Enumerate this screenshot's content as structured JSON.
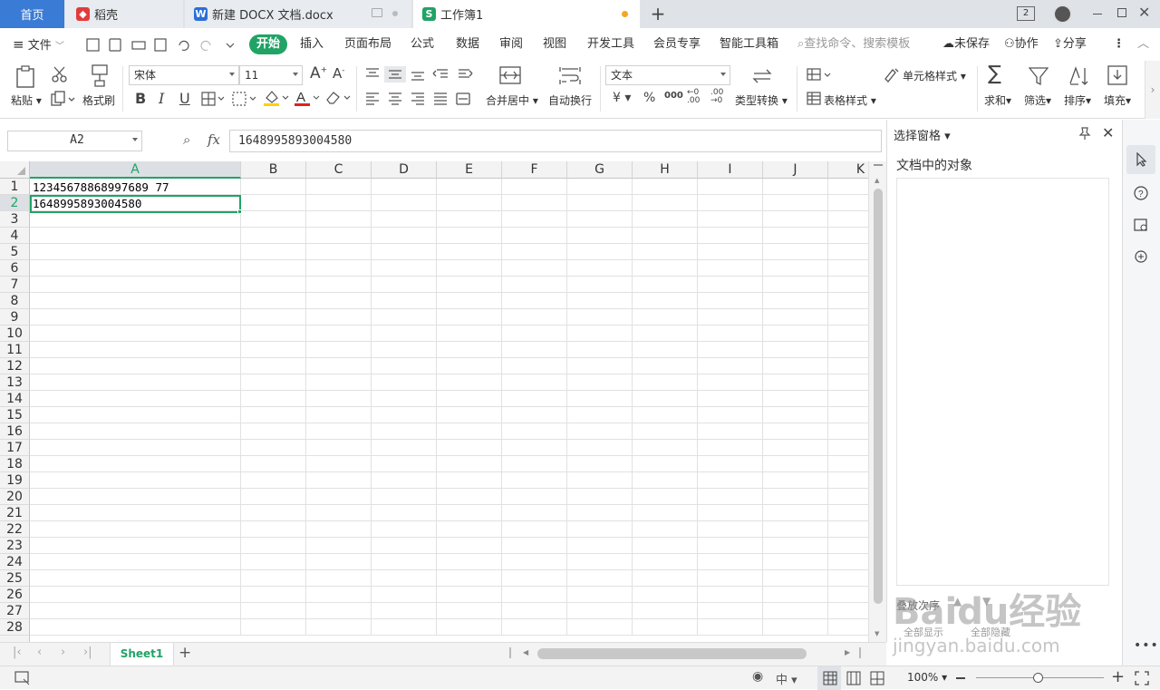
{
  "tabs": {
    "home": "首页",
    "docer": "稻壳",
    "docx": "新建 DOCX 文档.docx",
    "book": "工作簿1",
    "window_count": "2"
  },
  "menu": {
    "file": "文件",
    "items": [
      "开始",
      "插入",
      "页面布局",
      "公式",
      "数据",
      "审阅",
      "视图",
      "开发工具",
      "会员专享",
      "智能工具箱"
    ],
    "search": "查找命令、搜索模板",
    "unsaved": "未保存",
    "collab": "协作",
    "share": "分享"
  },
  "toolbar": {
    "paste": "粘贴",
    "format_painter": "格式刷",
    "font_name": "宋体",
    "font_size": "11",
    "merge_center": "合并居中",
    "wrap_text": "自动换行",
    "number_format": "文本",
    "currency_symbol": "¥",
    "percent_symbol": "%",
    "type_convert": "类型转换",
    "cell_style": "单元格样式",
    "table_style": "表格样式",
    "sum": "求和",
    "filter": "筛选",
    "sort": "排序",
    "fill": "填充",
    "bold": "B",
    "italic": "I",
    "underline": "U",
    "font_color_letter": "A"
  },
  "formula_bar": {
    "name_box": "A2",
    "fx": "fx",
    "value": "1648995893004580"
  },
  "grid": {
    "columns": [
      "A",
      "B",
      "C",
      "D",
      "E",
      "F",
      "G",
      "H",
      "I",
      "J",
      "K"
    ],
    "rows": [
      "1",
      "2",
      "3",
      "4",
      "5",
      "6",
      "7",
      "8",
      "9",
      "10",
      "11",
      "12",
      "13",
      "14",
      "15",
      "16",
      "17",
      "18",
      "19",
      "20",
      "21",
      "22",
      "23",
      "24",
      "25",
      "26",
      "27",
      "28"
    ],
    "cells": {
      "A1": "12345678868997689 77",
      "A2": "1648995893004580"
    },
    "active_cell": "A2",
    "accent": "#21a366"
  },
  "pane": {
    "title": "选择窗格",
    "subtitle": "文档中的对象",
    "order_label": "叠放次序",
    "show_all": "全部显示",
    "hide_all": "全部隐藏"
  },
  "sheets": {
    "tabs": [
      "Sheet1"
    ],
    "active": "Sheet1"
  },
  "status": {
    "zoom": "100%",
    "lang": "中"
  },
  "watermark": {
    "brand": "Baidu经验",
    "url": "jingyan.baidu.com"
  }
}
